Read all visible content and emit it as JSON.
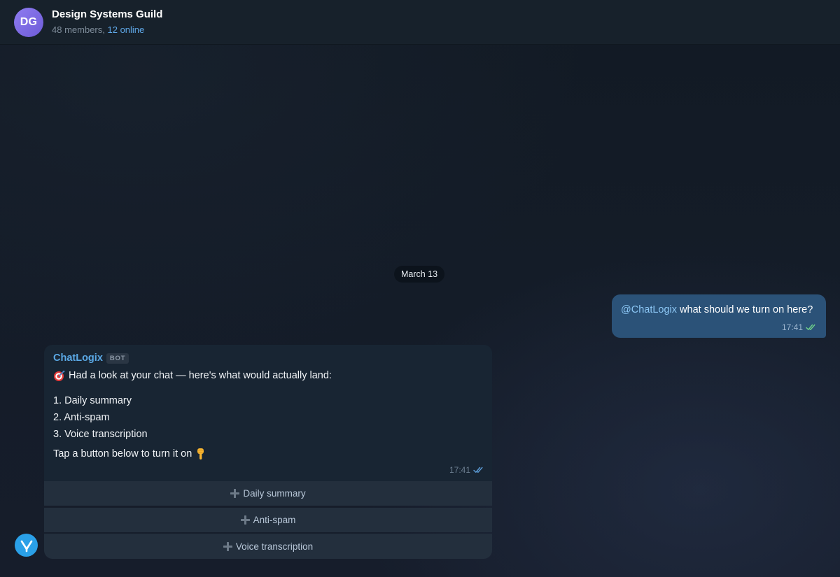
{
  "header": {
    "avatar_initials": "DG",
    "title": "Design Systems Guild",
    "members": "48 members,",
    "online": "12 online"
  },
  "date_divider": "March 13",
  "outgoing_message": {
    "mention": "@ChatLogix",
    "text": "what should we turn on here?",
    "time": "17:41",
    "status_icon": "double-check-icon"
  },
  "bot_message": {
    "sender": "ChatLogix",
    "badge": "BOT",
    "intro_icon": "target-dart-emoji",
    "intro": "Had a look at your chat — here's what would actually land:",
    "list": [
      "1. Daily summary",
      "2. Anti-spam",
      "3. Voice transcription"
    ],
    "cta": "Tap a button below to turn it on",
    "cta_icon": "pointing-down-emoji",
    "time": "17:41",
    "status_icon": "double-check-icon"
  },
  "inline_buttons": [
    {
      "label": "Daily summary",
      "icon": "plus-icon"
    },
    {
      "label": "Anti-spam",
      "icon": "plus-icon"
    },
    {
      "label": "Voice transcription",
      "icon": "plus-icon"
    }
  ],
  "colors": {
    "accent": "#5ba9e6",
    "outgoing_bubble": "#2b5278",
    "incoming_bubble": "#182533",
    "button": "#232f3d"
  }
}
